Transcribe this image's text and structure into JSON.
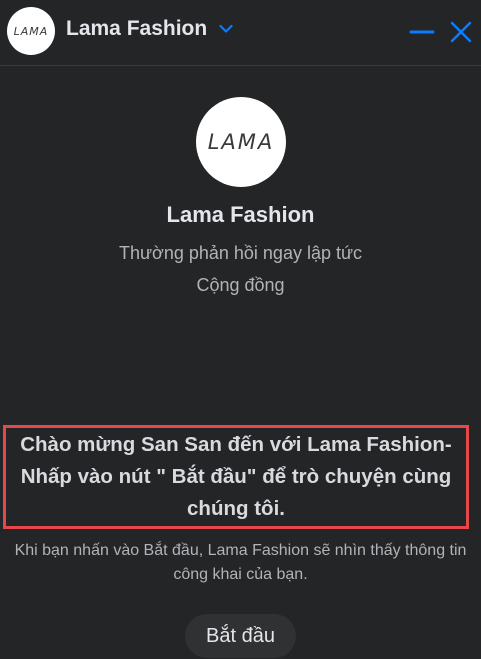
{
  "header": {
    "avatar_text": "LAMA",
    "title": "Lama Fashion"
  },
  "profile": {
    "avatar_text": "LAMA",
    "name": "Lama Fashion",
    "response_time": "Thường phản hồi ngay lập tức",
    "category": "Cộng đồng"
  },
  "welcome_message": "Chào mừng San San đến với Lama Fashion- Nhấp vào nút \" Bắt đầu\" để trò chuyện cùng chúng tôi.",
  "disclaimer": "Khi bạn nhấn vào Bắt đầu, Lama Fashion sẽ nhìn thấy thông tin công khai của bạn.",
  "start_button_label": "Bắt đầu",
  "colors": {
    "accent": "#0a7cff",
    "highlight_border": "#e5474b",
    "background": "#242526"
  },
  "icons": [
    "chevron-down-icon",
    "minimize-icon",
    "close-icon"
  ]
}
